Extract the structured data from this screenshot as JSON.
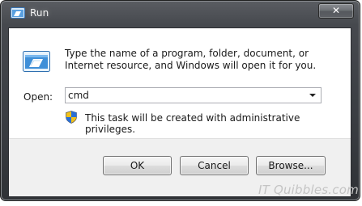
{
  "window": {
    "title": "Run",
    "close_label": "✕"
  },
  "dialog": {
    "description": "Type the name of a program, folder, document, or Internet resource, and Windows will open it for you.",
    "open_label": "Open:",
    "open_value": "cmd",
    "admin_notice": "This task will be created with administrative privileges."
  },
  "buttons": {
    "ok": "OK",
    "cancel": "Cancel",
    "browse": "Browse..."
  },
  "watermark": "IT Quibbles.com",
  "icons": {
    "title": "run-icon",
    "dialog": "run-icon",
    "dropdown": "chevron-down-icon",
    "uac": "uac-shield-icon"
  },
  "colors": {
    "frame": "#3a3d42",
    "content_bg": "#ffffff",
    "footer_bg": "#f0f0f0",
    "uac_blue": "#2a6fd6",
    "uac_yellow": "#f2c21b"
  }
}
